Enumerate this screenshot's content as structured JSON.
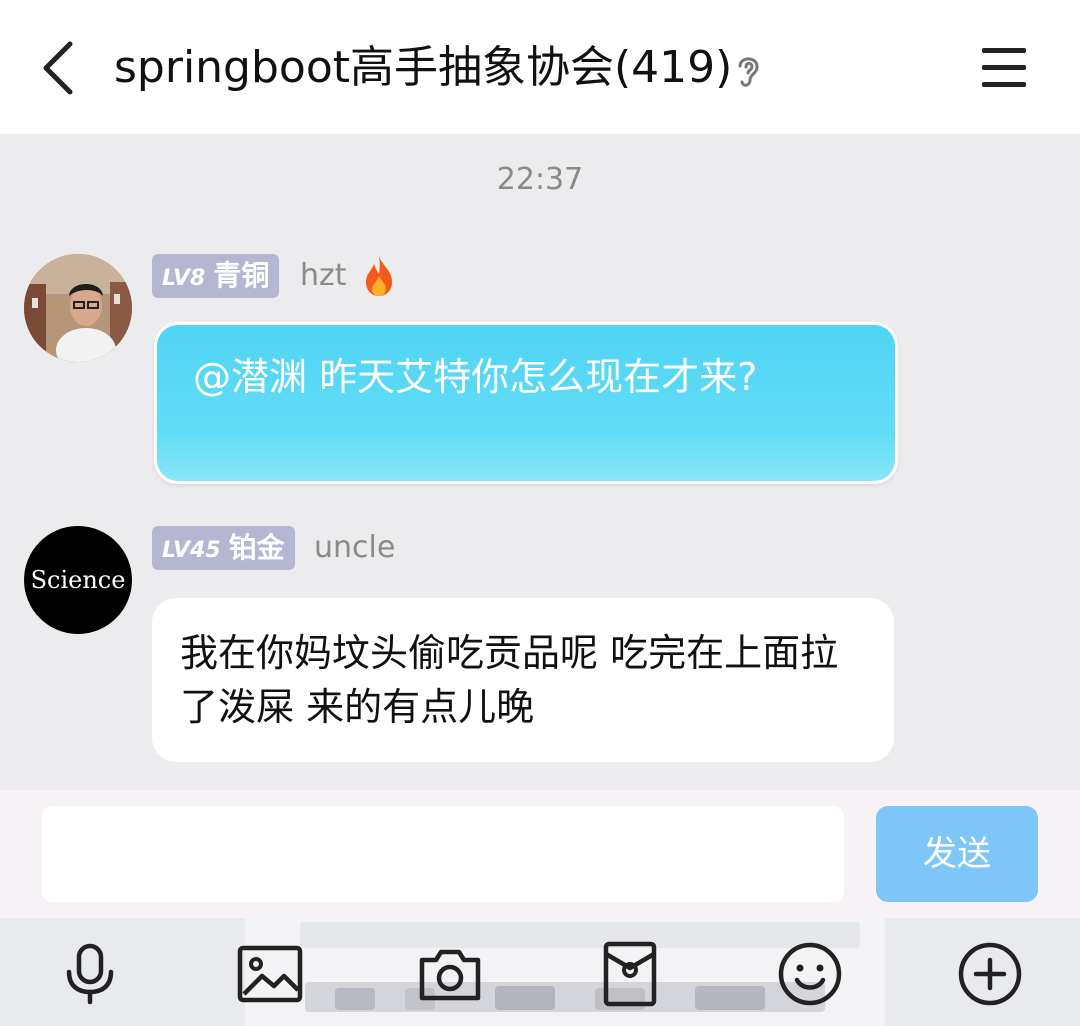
{
  "header": {
    "title": "springboot高手抽象协会(419)"
  },
  "chat": {
    "timestamp": "22:37",
    "messages": [
      {
        "level": "LV8",
        "rank": "青铜",
        "username": "hzt",
        "text": "@潜渊 昨天艾特你怎么现在才来?"
      },
      {
        "level": "LV45",
        "rank": "铂金",
        "username": "uncle",
        "avatar_text": "Science",
        "text": "我在你妈坟头偷吃贡品呢 吃完在上面拉了泼屎 来的有点儿晚"
      }
    ]
  },
  "composer": {
    "input_value": "",
    "send_label": "发送"
  },
  "toolbar": {
    "icons": [
      "microphone-icon",
      "image-icon",
      "camera-icon",
      "red-packet-icon",
      "emoji-icon",
      "plus-icon"
    ]
  },
  "colors": {
    "accent_bubble": "#4fd4f4",
    "send_button": "#7ec6f8",
    "badge": "#b4b6d2",
    "fire": "#f5591c"
  }
}
